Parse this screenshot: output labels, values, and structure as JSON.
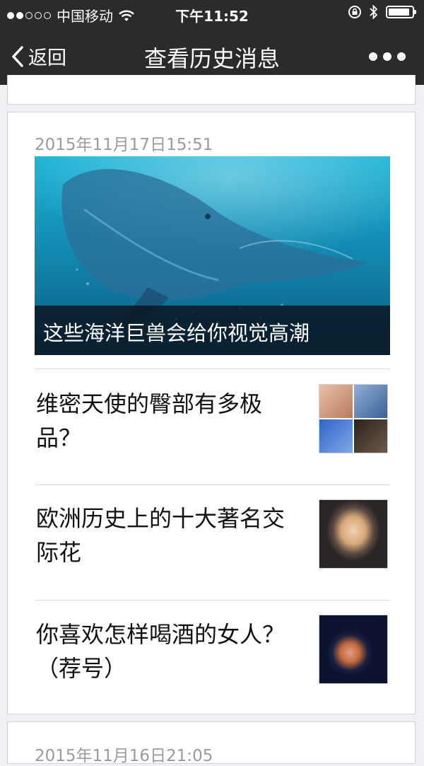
{
  "status_bar": {
    "carrier": "中国移动",
    "time": "下午11:52",
    "signal_dots_filled": 2,
    "signal_dots_total": 5
  },
  "nav": {
    "back_label": "返回",
    "title": "查看历史消息"
  },
  "groups": [
    {
      "date": "2015年11月17日15:51",
      "cover": {
        "caption": "这些海洋巨兽会给你视觉高潮"
      },
      "articles": [
        {
          "title": "维密天使的臀部有多极品？",
          "thumb_icon": "lingerie-collage-thumbnail"
        },
        {
          "title": "欧洲历史上的十大著名交际花",
          "thumb_icon": "woman-portrait-thumbnail"
        },
        {
          "title": "你喜欢怎样喝酒的女人？（荐号）",
          "thumb_icon": "woman-drinking-thumbnail"
        }
      ]
    },
    {
      "date": "2015年11月16日21:05"
    }
  ]
}
